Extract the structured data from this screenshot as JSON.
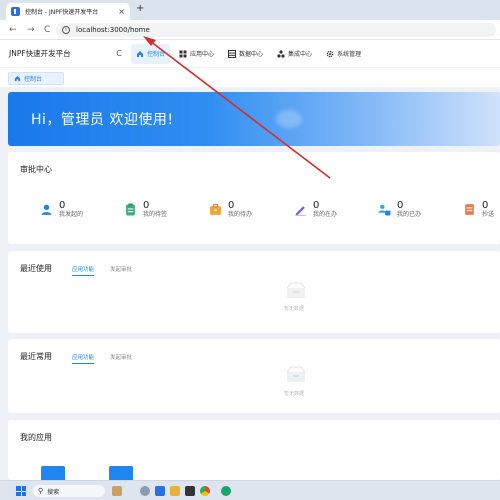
{
  "browser": {
    "tab_title": "控制台 - JNPF快速开发平台",
    "tab_close": "×",
    "new_tab": "+",
    "back": "←",
    "forward": "→",
    "reload": "C",
    "url": "localhost:3000/home"
  },
  "app": {
    "logo_mark": "JNPF",
    "logo_text": "JNPF快速开发平台",
    "refresh": "C",
    "menu": [
      {
        "label": "控制台",
        "icon": "home-icon",
        "active": true
      },
      {
        "label": "应用中心",
        "icon": "grid-icon",
        "active": false
      },
      {
        "label": "数据中心",
        "icon": "database-icon",
        "active": false
      },
      {
        "label": "集成中心",
        "icon": "integration-icon",
        "active": false
      },
      {
        "label": "系统管理",
        "icon": "gear-icon",
        "active": false
      }
    ],
    "tag": "控制台"
  },
  "banner": {
    "text": "Hi，管理员 欢迎使用!"
  },
  "approval": {
    "title": "审批中心",
    "items": [
      {
        "count": "0",
        "label": "我发起的",
        "icon": "user-icon",
        "color": "#1f86f0"
      },
      {
        "count": "0",
        "label": "我的待签",
        "icon": "clipboard-icon",
        "color": "#33b07a"
      },
      {
        "count": "0",
        "label": "我的待办",
        "icon": "briefcase-icon",
        "color": "#f0a33a"
      },
      {
        "count": "0",
        "label": "我的在办",
        "icon": "pen-icon",
        "color": "#7b61e8"
      },
      {
        "count": "0",
        "label": "我的已办",
        "icon": "users-check-icon",
        "color": "#2fa9e0"
      },
      {
        "count": "0",
        "label": "抄送",
        "icon": "document-icon",
        "color": "#f07a4a"
      }
    ]
  },
  "recent_used": {
    "title": "最近使用",
    "tabs": [
      "应用功能",
      "发起审批"
    ],
    "empty": "暂无数据"
  },
  "recent_frequent": {
    "title": "最近常用",
    "tabs": [
      "应用功能",
      "发起审批"
    ],
    "empty": "暂无数据"
  },
  "my_apps": {
    "title": "我的应用"
  },
  "taskbar": {
    "search": "搜索"
  },
  "colors": {
    "accent": "#1f86f0",
    "annotation": "#d32f2f"
  }
}
